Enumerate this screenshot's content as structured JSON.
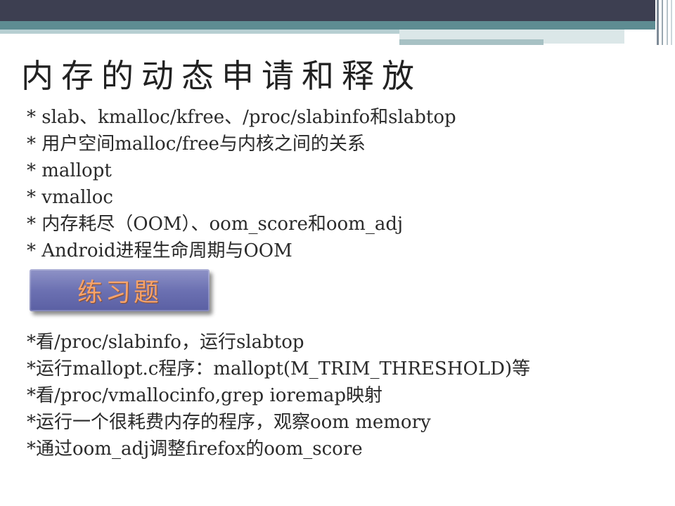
{
  "slide": {
    "title": "内存的动态申请和释放",
    "topics": [
      "* slab、kmalloc/kfree、/proc/slabinfo和slabtop",
      "* 用户空间malloc/free与内核之间的关系",
      "* mallopt",
      "* vmalloc",
      "* 内存耗尽（OOM）、oom_score和oom_adj",
      "* Android进程生命周期与OOM"
    ],
    "exercise_label": "练习题",
    "exercises": [
      "*看/proc/slabinfo，运行slabtop",
      "*运行mallopt.c程序：mallopt(M_TRIM_THRESHOLD)等",
      "*看/proc/vmallocinfo,grep ioremap映射",
      "*运行一个很耗费内存的程序，观察oom memory",
      "*通过oom_adj调整firefox的oom_score"
    ]
  },
  "colors": {
    "header_dark": "#3d3f51",
    "header_teal": "#5e8c92",
    "badge": "#6c71b2",
    "badge_text": "#f7a36a"
  }
}
